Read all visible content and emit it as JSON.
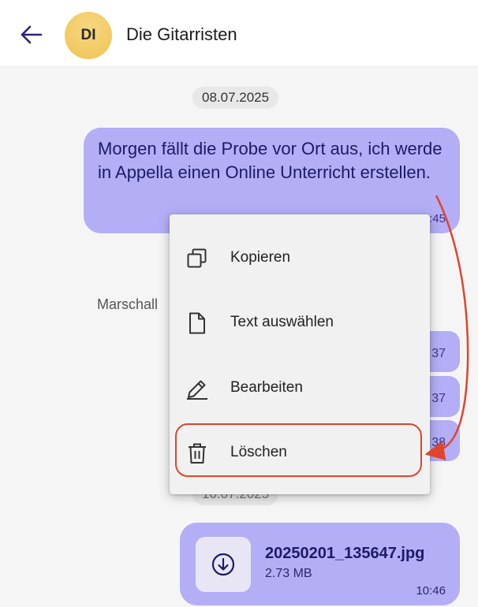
{
  "header": {
    "title": "Die Gitarristen",
    "avatar_initials": "DI",
    "back_icon": "arrow-left-icon"
  },
  "dates": [
    "08.07.2025",
    "10.07.2025"
  ],
  "messages": [
    {
      "text": "Morgen fällt die Probe vor Ort aus, ich werde in Appella einen Online Unterricht erstellen.",
      "time": "11:45"
    }
  ],
  "sender_label": "Marschall",
  "partial_times": [
    "37",
    "37",
    "38"
  ],
  "file_message": {
    "name": "20250201_135647.jpg",
    "size": "2.73 MB",
    "time": "10:46",
    "icon": "download-icon"
  },
  "context_menu": {
    "items": [
      {
        "label": "Kopieren",
        "icon": "copy-icon"
      },
      {
        "label": "Text auswählen",
        "icon": "document-icon"
      },
      {
        "label": "Bearbeiten",
        "icon": "pencil-icon"
      },
      {
        "label": "Löschen",
        "icon": "trash-icon"
      }
    ]
  },
  "colors": {
    "bubble": "#b3aef6",
    "accent": "#3d2a8c",
    "annotation": "#e0442c"
  }
}
